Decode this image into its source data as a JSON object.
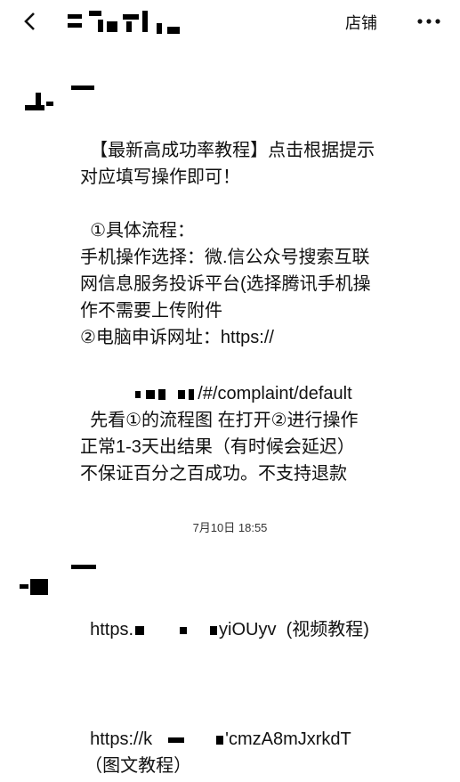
{
  "header": {
    "back_icon": "chevron-left-icon",
    "store_label": "店铺",
    "more_icon": "ellipsis-icon"
  },
  "messages": [
    {
      "text_block_1": "【最新高成功率教程】点击根据提示对应填写操作即可！",
      "text_block_2": "①具体流程：\n手机操作选择：微.信公众号搜索互联网信息服务投诉平台(选择腾讯手机操作不需要上传附件\n②电脑申诉网址：https://",
      "url_suffix": "/#/complaint/default",
      "text_block_3": "先看①的流程图 在打开②进行操作  正常1-3天出结果（有时候会延迟）\n不保证百分之百成功。不支持退款"
    },
    {
      "link1_prefix": "https.",
      "link1_suffix": "yiOUyv",
      "link1_note": "(视频教程)",
      "link2_prefix": "https://k",
      "link2_suffix": "'cmzA8mJxrkdT",
      "link2_note": "（图文教程）"
    }
  ],
  "timestamp": "7月10日 18:55"
}
